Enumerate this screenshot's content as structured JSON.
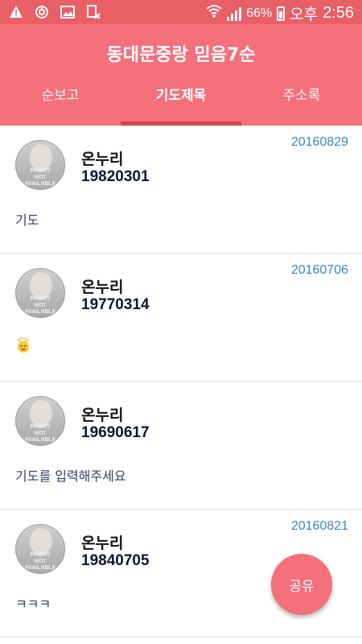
{
  "statusbar": {
    "battery": "66%",
    "ampm": "오후",
    "time": "2:56",
    "icons": [
      "warning-icon",
      "power-icon",
      "image-icon",
      "document-x-icon",
      "wifi-icon",
      "signal-icon",
      "battery-icon"
    ]
  },
  "header": {
    "title": "동대문중랑 믿음7순"
  },
  "tabs": [
    {
      "label": "순보고",
      "active": false
    },
    {
      "label": "기도제목",
      "active": true
    },
    {
      "label": "주소록",
      "active": false
    }
  ],
  "avatar_placeholder": {
    "line1": "PHOTO",
    "line2": "NOT",
    "line3": "AVAILABLE"
  },
  "items": [
    {
      "name": "온누리",
      "birth": "19820301",
      "date": "20160829",
      "prayer": "기도"
    },
    {
      "name": "온누리",
      "birth": "19770314",
      "date": "20160706",
      "prayer": "",
      "emoji": "angel-face-emoji"
    },
    {
      "name": "온누리",
      "birth": "19690617",
      "date": "",
      "prayer": "기도를 입력해주세요"
    },
    {
      "name": "온누리",
      "birth": "19840705",
      "date": "20160821",
      "prayer": "ㅋㅋㅋ"
    }
  ],
  "fab": {
    "label": "공유"
  },
  "colors": {
    "primary": "#f4707b",
    "statusbar": "#e85f66",
    "indicator": "#d8434f",
    "date": "#3a86c8"
  }
}
